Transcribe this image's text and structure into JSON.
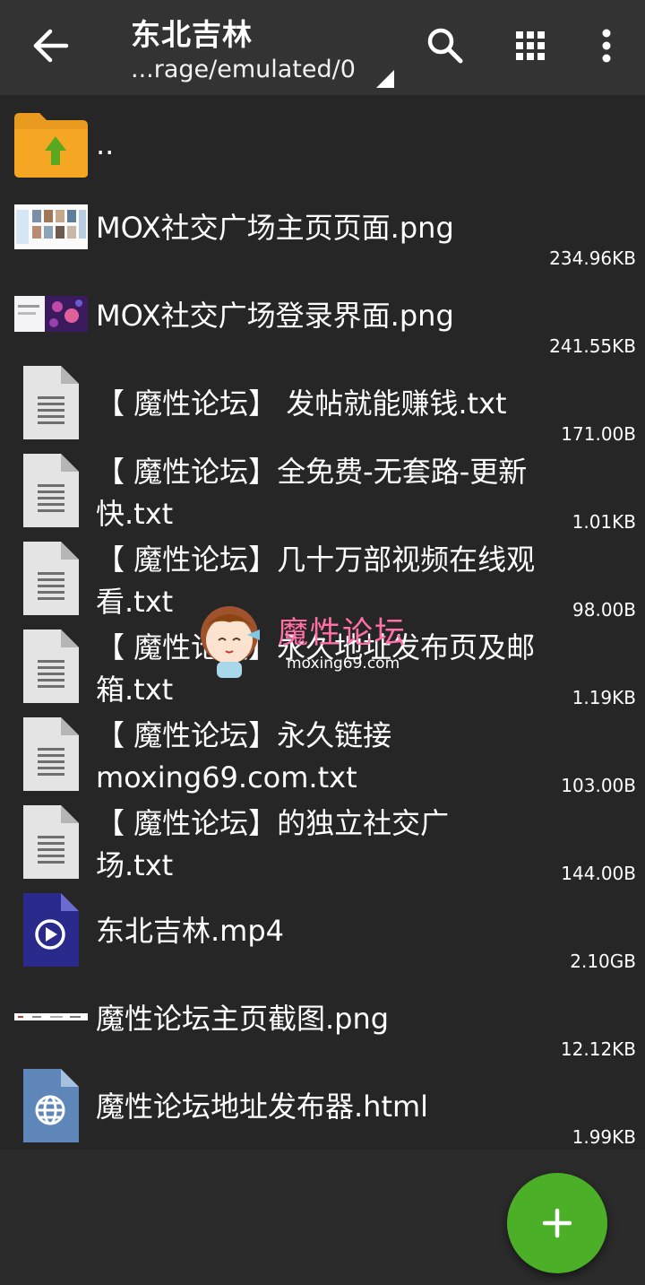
{
  "header": {
    "title": "东北吉林",
    "path": "...rage/emulated/0",
    "icons": [
      "back-arrow-icon",
      "search-icon",
      "grid-view-icon",
      "more-vert-icon"
    ]
  },
  "files": [
    {
      "name": "..",
      "size": "",
      "type": "parent-folder"
    },
    {
      "name": "MOX社交广场主页页面.png",
      "size": "234.96KB",
      "type": "image"
    },
    {
      "name": "MOX社交广场登录界面.png",
      "size": "241.55KB",
      "type": "image"
    },
    {
      "name": "【 魔性论坛】 发帖就能赚钱.txt",
      "size": "171.00B",
      "type": "text"
    },
    {
      "name": "【 魔性论坛】全免费-无套路-更新快.txt",
      "size": "1.01KB",
      "type": "text"
    },
    {
      "name": "【 魔性论坛】几十万部视频在线观看.txt",
      "size": "98.00B",
      "type": "text"
    },
    {
      "name": "【 魔性论坛】永久地址发布页及邮箱.txt",
      "size": "1.19KB",
      "type": "text"
    },
    {
      "name": "【 魔性论坛】永久链接moxing69.com.txt",
      "size": "103.00B",
      "type": "text"
    },
    {
      "name": "【 魔性论坛】的独立社交广场.txt",
      "size": "144.00B",
      "type": "text"
    },
    {
      "name": "东北吉林.mp4",
      "size": "2.10GB",
      "type": "video"
    },
    {
      "name": "魔性论坛主页截图.png",
      "size": "12.12KB",
      "type": "image"
    },
    {
      "name": "魔性论坛地址发布器.html",
      "size": "1.99KB",
      "type": "html"
    }
  ],
  "watermark": {
    "text": "魔性论坛",
    "url": "moxing69.com"
  },
  "fab": {
    "icon": "plus-icon"
  },
  "colors": {
    "toolbar": "#333333",
    "background": "#262626",
    "fab": "#4caf28",
    "folder": "#f5a623"
  }
}
